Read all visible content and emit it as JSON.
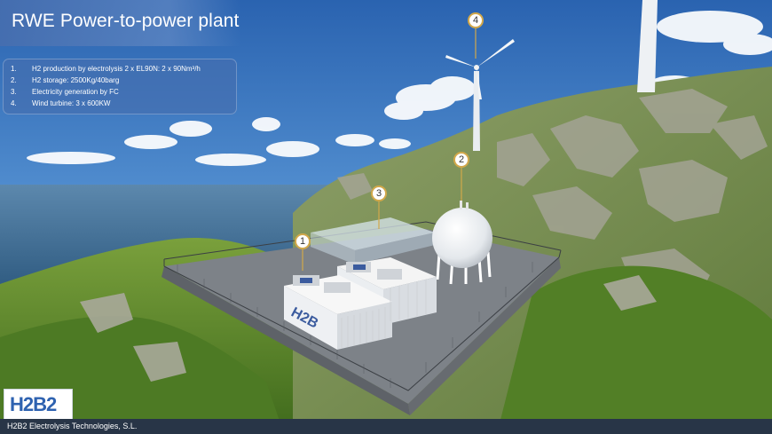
{
  "title": "RWE Power-to-power plant",
  "specs": [
    {
      "num": "1.",
      "text": "H2 production by electrolysis 2 x EL90N: 2 x 90Nm³/h"
    },
    {
      "num": "2.",
      "text": "H2 storage: 2500Kg/40barg"
    },
    {
      "num": "3.",
      "text": "Electricity generation by FC"
    },
    {
      "num": "4.",
      "text": "Wind turbine: 3 x 600KW"
    }
  ],
  "markers": [
    "1",
    "2",
    "3",
    "4"
  ],
  "logo": "H2B2",
  "container_lettering": "H2B",
  "footer": "H2B2 Electrolysis Technologies, S.L.",
  "colors": {
    "sky": "#3d7fc8",
    "grass": "#5e8f2c",
    "rock": "#9a9a8c",
    "sea": "#3f6f98",
    "panel": "#466eaf",
    "marker_ring": "#d2a84a",
    "footer": "#283547",
    "logo_blue": "#2e62b0"
  }
}
